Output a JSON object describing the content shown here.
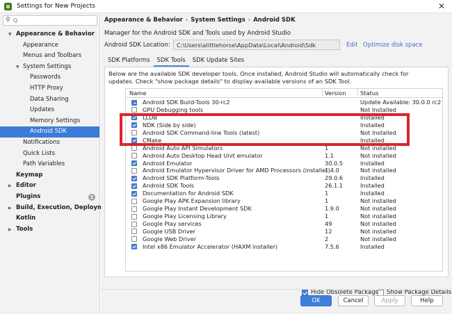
{
  "window": {
    "title": "Settings for New Projects",
    "close_glyph": "✕"
  },
  "sidebar": {
    "search_placeholder": "Q",
    "items": [
      {
        "label": "Appearance & Behavior",
        "expanded": true
      },
      {
        "label": "Appearance"
      },
      {
        "label": "Menus and Toolbars"
      },
      {
        "label": "System Settings",
        "expanded": true
      },
      {
        "label": "Passwords"
      },
      {
        "label": "HTTP Proxy"
      },
      {
        "label": "Data Sharing"
      },
      {
        "label": "Updates"
      },
      {
        "label": "Memory Settings"
      },
      {
        "label": "Android SDK",
        "selected": true
      },
      {
        "label": "Notifications"
      },
      {
        "label": "Quick Lists"
      },
      {
        "label": "Path Variables"
      },
      {
        "label": "Keymap"
      },
      {
        "label": "Editor"
      },
      {
        "label": "Plugins",
        "badge": "1"
      },
      {
        "label": "Build, Execution, Deployment"
      },
      {
        "label": "Kotlin"
      },
      {
        "label": "Tools"
      }
    ]
  },
  "main": {
    "breadcrumb": [
      "Appearance & Behavior",
      "System Settings",
      "Android SDK"
    ],
    "breadcrumb_sep": "›",
    "description": "Manager for the Android SDK and Tools used by Android Studio",
    "sdk_location_label": "Android SDK Location:",
    "sdk_location_value": "C:\\Users\\alittlehorse\\AppData\\Local\\Android\\Sdk",
    "edit_link": "Edit",
    "optimize_link": "Optimize disk space",
    "tabs": [
      "SDK Platforms",
      "SDK Tools",
      "SDK Update Sites"
    ],
    "active_tab": "SDK Tools",
    "panel_description_1": "Below are the available SDK developer tools. Once installed, Android Studio will automatically check for",
    "panel_description_2": "updates. Check \"show package details\" to display available versions of an SDK Tool.",
    "table": {
      "columns": [
        "Name",
        "Version",
        "Status"
      ],
      "rows": [
        {
          "check": "partial",
          "name": "Android SDK Build-Tools 30-rc2",
          "version": "",
          "status": "Update Available: 30.0.0 rc2"
        },
        {
          "check": "none",
          "name": "GPU Debugging tools",
          "version": "",
          "status": "Not Installed"
        },
        {
          "check": "checked",
          "name": "LLDB",
          "version": "",
          "status": "Installed"
        },
        {
          "check": "checked",
          "name": "NDK (Side by side)",
          "version": "",
          "status": "Installed"
        },
        {
          "check": "none",
          "name": "Android SDK Command-line Tools (latest)",
          "version": "",
          "status": "Not Installed"
        },
        {
          "check": "checked",
          "name": "CMake",
          "version": "",
          "status": "Installed"
        },
        {
          "check": "none",
          "name": "Android Auto API Simulators",
          "version": "1",
          "status": "Not installed"
        },
        {
          "check": "none",
          "name": "Android Auto Desktop Head Unit emulator",
          "version": "1.1",
          "status": "Not installed"
        },
        {
          "check": "checked",
          "name": "Android Emulator",
          "version": "30.0.5",
          "status": "Installed"
        },
        {
          "check": "none",
          "name": "Android Emulator Hypervisor Driver for AMD Processors (installer)",
          "version": "1.4.0",
          "status": "Not installed"
        },
        {
          "check": "checked",
          "name": "Android SDK Platform-Tools",
          "version": "29.0.6",
          "status": "Installed"
        },
        {
          "check": "checked",
          "name": "Android SDK Tools",
          "version": "26.1.1",
          "status": "Installed"
        },
        {
          "check": "checked",
          "name": "Documentation for Android SDK",
          "version": "1",
          "status": "Installed"
        },
        {
          "check": "none",
          "name": "Google Play APK Expansion library",
          "version": "1",
          "status": "Not installed"
        },
        {
          "check": "none",
          "name": "Google Play Instant Development SDK",
          "version": "1.9.0",
          "status": "Not installed"
        },
        {
          "check": "none",
          "name": "Google Play Licensing Library",
          "version": "1",
          "status": "Not installed"
        },
        {
          "check": "none",
          "name": "Google Play services",
          "version": "49",
          "status": "Not installed"
        },
        {
          "check": "none",
          "name": "Google USB Driver",
          "version": "12",
          "status": "Not installed"
        },
        {
          "check": "none",
          "name": "Google Web Driver",
          "version": "2",
          "status": "Not installed"
        },
        {
          "check": "checked",
          "name": "Intel x86 Emulator Accelerator (HAXM installer)",
          "version": "7.5.6",
          "status": "Installed"
        }
      ]
    },
    "hide_obsolete_label": "Hide Obsolete Packages",
    "hide_obsolete_checked": true,
    "show_details_label": "Show Package Details",
    "show_details_checked": false
  },
  "buttons": {
    "ok": "OK",
    "cancel": "Cancel",
    "apply": "Apply",
    "help": "Help"
  },
  "colors": {
    "accent": "#3d7bd9",
    "link": "#3c72c4",
    "highlight_box": "#d9252e"
  }
}
